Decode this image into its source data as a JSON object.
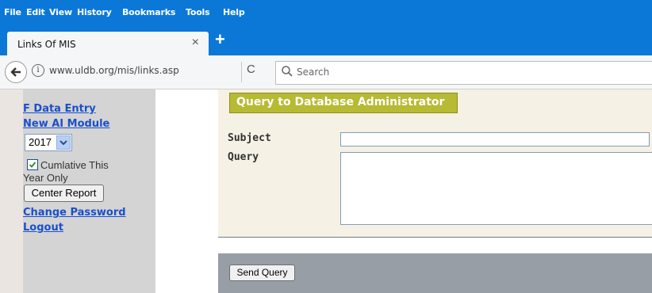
{
  "menu": [
    "File",
    "Edit",
    "View",
    "History",
    "Bookmarks",
    "Tools",
    "Help"
  ],
  "tab": {
    "title": "Links Of MIS",
    "close": "×",
    "new_tab": "+"
  },
  "nav": {
    "url": "www.uldb.org/mis/links.asp",
    "reload": "C",
    "search_placeholder": "Search"
  },
  "sidebar": {
    "f_data_entry": "F Data Entry",
    "new_ai_module": "New AI Module",
    "year": "2017",
    "cumulative_label_line1": "Cumlative This",
    "cumulative_label_line2": "Year Only",
    "cumulative_checked": true,
    "center_report": "Center Report",
    "change_password": "Change Password",
    "logout": "Logout"
  },
  "form": {
    "title": "Query to Database Administrator",
    "subject_label": "Subject",
    "query_label": "Query",
    "subject_value": "",
    "query_value": "",
    "send_button": "Send Query"
  },
  "colors": {
    "browser_chrome": "#0b78d8",
    "sidebar_bg": "#d4d4d4",
    "link": "#1a4fcc",
    "title_banner": "#b7ba33",
    "form_panel": "#f5f1e4",
    "send_bar": "#979ea5"
  }
}
